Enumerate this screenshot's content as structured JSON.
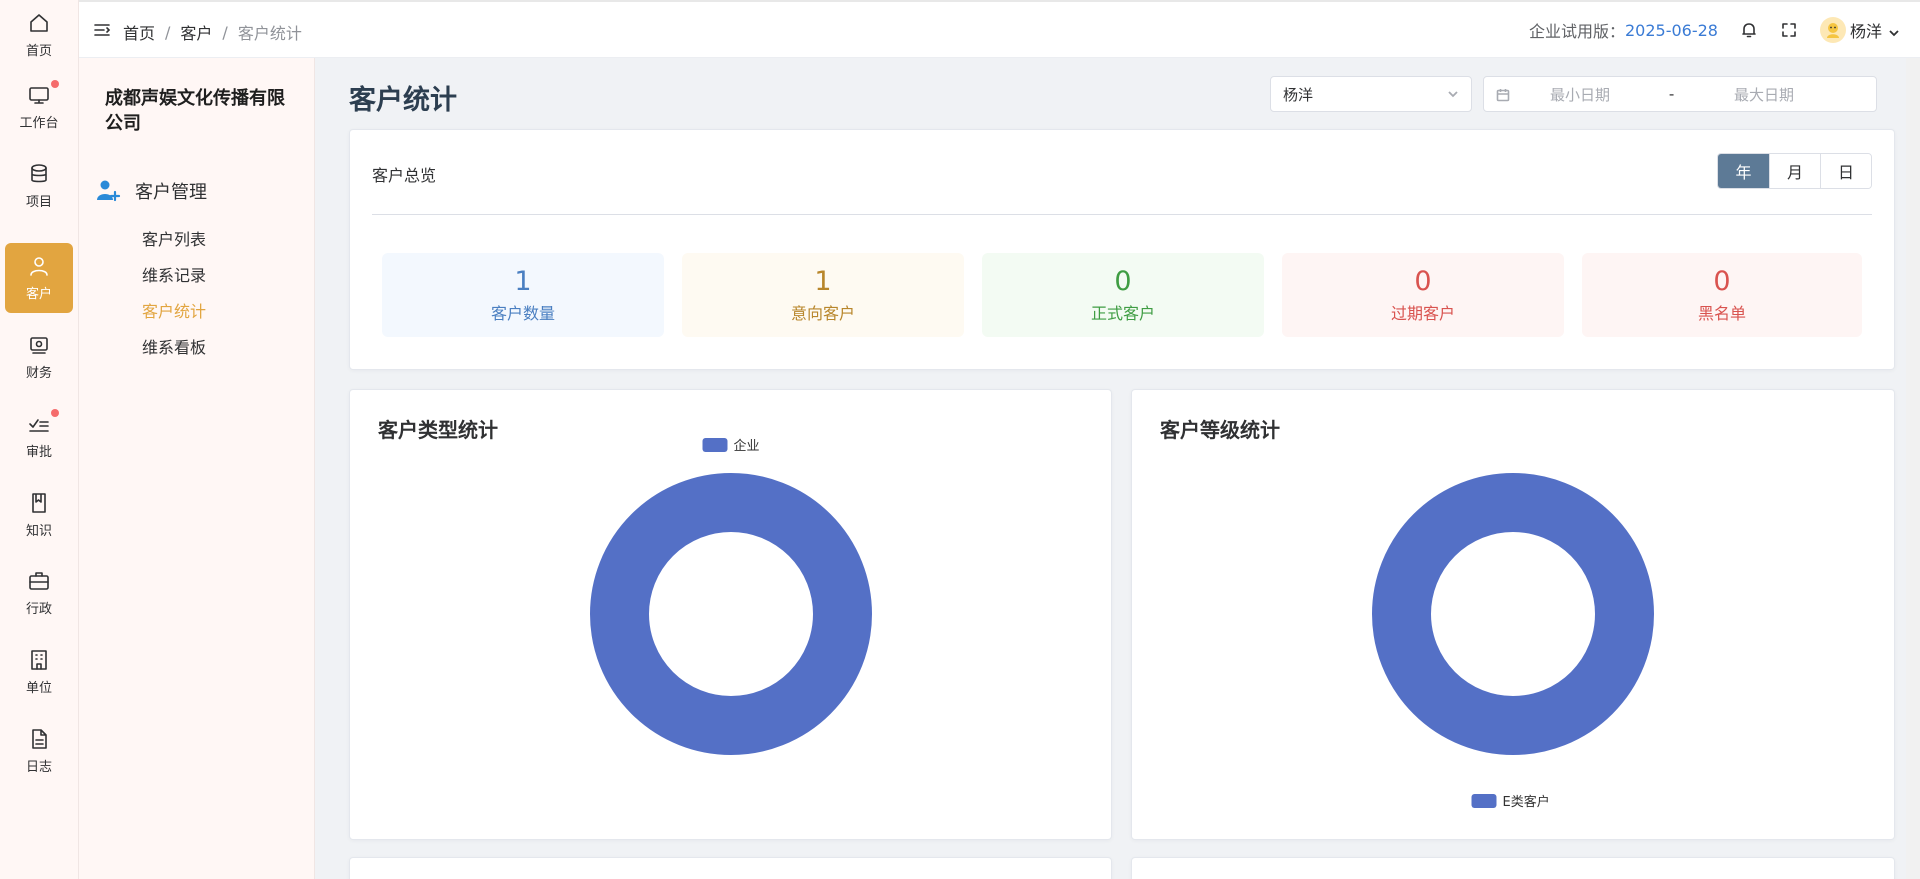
{
  "rail": {
    "items": [
      {
        "label": "首页",
        "icon": "home-icon"
      },
      {
        "label": "工作台",
        "icon": "monitor-icon",
        "dot": true
      },
      {
        "label": "项目",
        "icon": "database-icon"
      },
      {
        "label": "客户",
        "icon": "user-icon",
        "active": true
      },
      {
        "label": "财务",
        "icon": "wallet-icon"
      },
      {
        "label": "审批",
        "icon": "checklist-icon",
        "dot": true
      },
      {
        "label": "知识",
        "icon": "book-icon"
      },
      {
        "label": "行政",
        "icon": "briefcase-icon"
      },
      {
        "label": "单位",
        "icon": "building-icon"
      },
      {
        "label": "日志",
        "icon": "document-icon"
      }
    ]
  },
  "header": {
    "breadcrumb": [
      "首页",
      "客户",
      "客户统计"
    ],
    "breadcrumb_sep": "/",
    "trial_label": "企业试用版：",
    "trial_date": "2025-06-28",
    "user_name": "杨洋"
  },
  "subnav": {
    "company": "成都声娱文化传播有限公司",
    "group_title": "客户管理",
    "items": [
      {
        "label": "客户列表"
      },
      {
        "label": "维系记录"
      },
      {
        "label": "客户统计",
        "active": true
      },
      {
        "label": "维系看板"
      }
    ]
  },
  "main": {
    "title": "客户统计",
    "filter_user": "杨洋",
    "date_start_placeholder": "最小日期",
    "date_sep": "-",
    "date_end_placeholder": "最大日期"
  },
  "overview": {
    "title": "客户总览",
    "periods": [
      {
        "label": "年",
        "active": true
      },
      {
        "label": "月"
      },
      {
        "label": "日"
      }
    ],
    "stats": [
      {
        "value": "1",
        "label": "客户数量",
        "color": "#4a7fc1",
        "bg": "#f3f8fe"
      },
      {
        "value": "1",
        "label": "意向客户",
        "color": "#b8862b",
        "bg": "#fefaf2"
      },
      {
        "value": "0",
        "label": "正式客户",
        "color": "#3f9d43",
        "bg": "#f3fbf3"
      },
      {
        "value": "0",
        "label": "过期客户",
        "color": "#d9534f",
        "bg": "#fef5f4"
      },
      {
        "value": "0",
        "label": "黑名单",
        "color": "#d9534f",
        "bg": "#fef5f4"
      }
    ]
  },
  "chart_data": [
    {
      "type": "pie",
      "title": "客户类型统计",
      "categories": [
        "企业"
      ],
      "values": [
        1
      ],
      "colors": [
        "#5470c6"
      ],
      "legend": "top-center"
    },
    {
      "type": "pie",
      "title": "客户等级统计",
      "categories": [
        "E类客户"
      ],
      "values": [
        1
      ],
      "colors": [
        "#5470c6"
      ],
      "legend": "bottom-center"
    }
  ],
  "colors": {
    "accent": "#e2a540",
    "segment_active": "#5d7a96",
    "link": "#3a7bd5"
  }
}
